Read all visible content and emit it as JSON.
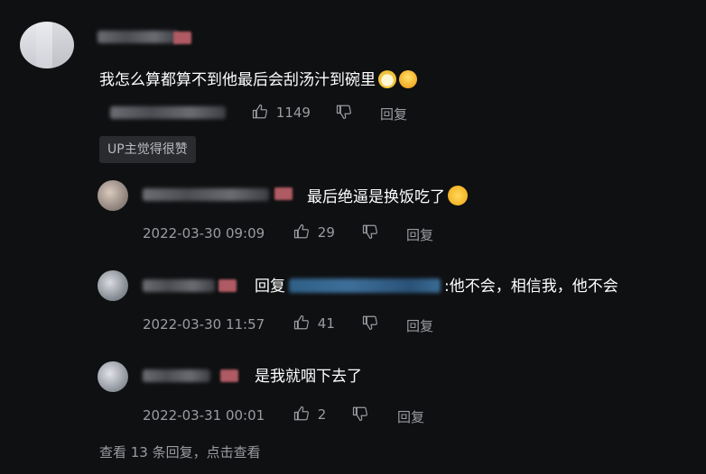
{
  "main_comment": {
    "text": "我怎么算都算不到他最后会刮汤汁到碗里",
    "emoji_1": "bowl-emoji",
    "emoji_2": "scream-emoji",
    "likes": "1149",
    "reply_label": "回复",
    "up_badge": "UP主觉得很赞"
  },
  "replies": [
    {
      "text": "最后绝逼是换饭吃了",
      "emoji": "cat-emoji",
      "timestamp": "2022-03-30 09:09",
      "likes": "29",
      "reply_label": "回复"
    },
    {
      "prefix": "回复",
      "text": ":他不会，相信我，他不会",
      "timestamp": "2022-03-30 11:57",
      "likes": "41",
      "reply_label": "回复"
    },
    {
      "text": "是我就咽下去了",
      "timestamp": "2022-03-31 00:01",
      "likes": "2",
      "reply_label": "回复"
    }
  ],
  "footer": {
    "view_more": "查看 13 条回复，点击查看"
  },
  "colors": {
    "background": "#0f1012",
    "text": "#ffffff",
    "meta": "#9a9ca2",
    "mention": "#3d6f9a"
  }
}
